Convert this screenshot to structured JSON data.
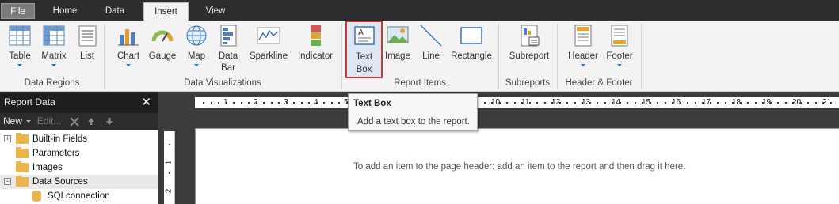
{
  "tabs": {
    "file": "File",
    "home": "Home",
    "data": "Data",
    "insert": "Insert",
    "view": "View"
  },
  "ribbon": {
    "buttons": {
      "table": "Table",
      "matrix": "Matrix",
      "list": "List",
      "chart": "Chart",
      "gauge": "Gauge",
      "map": "Map",
      "data_bar": "Data Bar",
      "sparkline": "Sparkline",
      "indicator": "Indicator",
      "text_box": "Text Box",
      "image": "Image",
      "line": "Line",
      "rectangle": "Rectangle",
      "subreport": "Subreport",
      "header": "Header",
      "footer": "Footer"
    },
    "groups": {
      "data_regions": "Data Regions",
      "data_visualizations": "Data Visualizations",
      "report_items": "Report Items",
      "subreports": "Subreports",
      "header_footer": "Header & Footer"
    },
    "icons": [
      "table-icon",
      "matrix-icon",
      "list-icon",
      "chart-icon",
      "gauge-icon",
      "map-icon",
      "data-bar-icon",
      "sparkline-icon",
      "indicator-icon",
      "text-box-icon",
      "image-icon",
      "line-icon",
      "rectangle-icon",
      "subreport-icon",
      "header-icon",
      "footer-icon"
    ]
  },
  "tooltip": {
    "title": "Text Box",
    "description": "Add a text box to the report."
  },
  "report_data": {
    "title": "Report Data",
    "close": "✕",
    "new_label": "New",
    "edit_label": "Edit...",
    "tree": [
      {
        "label": "Built-in Fields",
        "expander": "+"
      },
      {
        "label": "Parameters"
      },
      {
        "label": "Images"
      },
      {
        "label": "Data Sources",
        "expander": "−"
      },
      {
        "label": "SQLconnection"
      }
    ]
  },
  "ruler": {
    "horizontal": [
      "1",
      "2",
      "3",
      "4",
      "5",
      "10",
      "11",
      "12",
      "13",
      "14",
      "15",
      "16",
      "17",
      "18",
      "19",
      "20",
      "21"
    ],
    "vertical": [
      "1",
      "2"
    ]
  },
  "design": {
    "hint": "To add an item to the page header: add an item to the report and then drag it here."
  },
  "colors": {
    "accent": "#1b6fc2",
    "highlight_border": "#c23b3b",
    "folder": "#e8b54f"
  }
}
